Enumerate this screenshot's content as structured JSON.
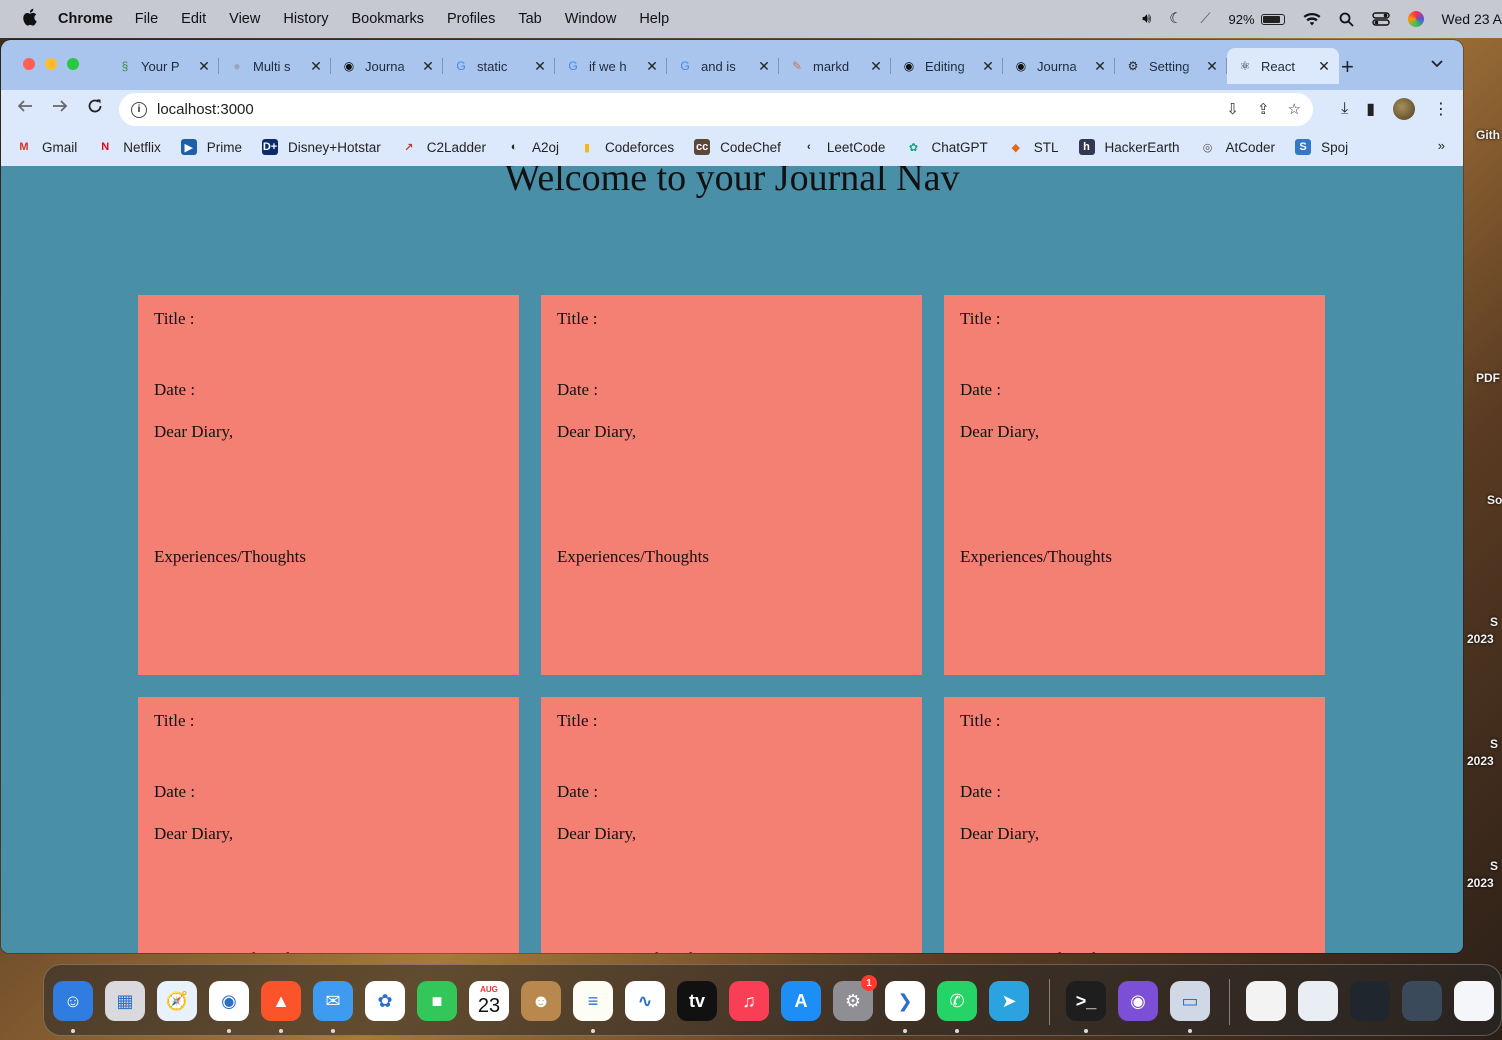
{
  "menubar": {
    "app_name": "Chrome",
    "items": [
      "File",
      "Edit",
      "View",
      "History",
      "Bookmarks",
      "Profiles",
      "Tab",
      "Window",
      "Help"
    ],
    "battery": "92%",
    "clock": "Wed 23 A"
  },
  "tabs": [
    {
      "label": "Your P",
      "icon": "tab-favicon",
      "color": "#3a8f3a",
      "glyph": "§"
    },
    {
      "label": "Multi s",
      "icon": "tab-favicon",
      "color": "#9aa6b8",
      "glyph": "●"
    },
    {
      "label": "Journa",
      "icon": "github-icon",
      "color": "#111111",
      "glyph": "◉"
    },
    {
      "label": "static",
      "icon": "google-icon",
      "color": "#4285f4",
      "glyph": "G"
    },
    {
      "label": "if we h",
      "icon": "google-icon",
      "color": "#4285f4",
      "glyph": "G"
    },
    {
      "label": "and is",
      "icon": "google-icon",
      "color": "#4285f4",
      "glyph": "G"
    },
    {
      "label": "markd",
      "icon": "tab-favicon",
      "color": "#c27a5a",
      "glyph": "✎"
    },
    {
      "label": "Editing",
      "icon": "github-icon",
      "color": "#111111",
      "glyph": "◉"
    },
    {
      "label": "Journa",
      "icon": "github-icon",
      "color": "#111111",
      "glyph": "◉"
    },
    {
      "label": "Setting",
      "icon": "gear-icon",
      "color": "#222222",
      "glyph": "⚙"
    },
    {
      "label": "React",
      "icon": "react-icon",
      "color": "#1b2a3a",
      "glyph": "⚛"
    }
  ],
  "address": {
    "url": "localhost:3000"
  },
  "bookmarks": [
    {
      "label": "Gmail",
      "glyph": "M",
      "color": "#d93025",
      "bg": "transparent"
    },
    {
      "label": "Netflix",
      "glyph": "N",
      "color": "#e50914",
      "bg": "transparent"
    },
    {
      "label": "Prime",
      "glyph": "▶",
      "color": "#ffffff",
      "bg": "#1f5fa8"
    },
    {
      "label": "Disney+Hotstar",
      "glyph": "D+",
      "color": "#ffffff",
      "bg": "#0b2b6b"
    },
    {
      "label": "C2Ladder",
      "glyph": "↗",
      "color": "#c0392b",
      "bg": "transparent"
    },
    {
      "label": "A2oj",
      "glyph": "◐",
      "color": "#222222",
      "bg": "transparent"
    },
    {
      "label": "Codeforces",
      "glyph": "▮",
      "color": "#f3b81a",
      "bg": "transparent"
    },
    {
      "label": "CodeChef",
      "glyph": "cc",
      "color": "#ffffff",
      "bg": "#5b4638"
    },
    {
      "label": "LeetCode",
      "glyph": "‹",
      "color": "#222222",
      "bg": "transparent"
    },
    {
      "label": "ChatGPT",
      "glyph": "✿",
      "color": "#10a37f",
      "bg": "transparent"
    },
    {
      "label": "STL",
      "glyph": "◆",
      "color": "#e06a1b",
      "bg": "transparent"
    },
    {
      "label": "HackerEarth",
      "glyph": "h",
      "color": "#ffffff",
      "bg": "#323754"
    },
    {
      "label": "AtCoder",
      "glyph": "◎",
      "color": "#555555",
      "bg": "transparent"
    },
    {
      "label": "Spoj",
      "glyph": "S",
      "color": "#ffffff",
      "bg": "#3178c6"
    }
  ],
  "page": {
    "heading": "Welcome to your Journal Nav",
    "cards": [
      {
        "title_label": "Title :",
        "date_label": "Date :",
        "greeting": "Dear Diary,",
        "body_label": "Experiences/Thoughts"
      },
      {
        "title_label": "Title :",
        "date_label": "Date :",
        "greeting": "Dear Diary,",
        "body_label": "Experiences/Thoughts"
      },
      {
        "title_label": "Title :",
        "date_label": "Date :",
        "greeting": "Dear Diary,",
        "body_label": "Experiences/Thoughts"
      },
      {
        "title_label": "Title :",
        "date_label": "Date :",
        "greeting": "Dear Diary,",
        "body_label": "Experiences/Thoughts"
      },
      {
        "title_label": "Title :",
        "date_label": "Date :",
        "greeting": "Dear Diary,",
        "body_label": "Experiences/Thoughts"
      },
      {
        "title_label": "Title :",
        "date_label": "Date :",
        "greeting": "Dear Diary,",
        "body_label": "Experiences/Thoughts"
      }
    ]
  },
  "desktop_labels": [
    "Gith",
    "PDF",
    "So",
    "S",
    "2023",
    "S",
    "2023",
    "S",
    "2023"
  ],
  "dock": {
    "calendar_month": "AUG",
    "calendar_day": "23",
    "settings_badge": "1",
    "apps": [
      {
        "name": "finder-icon",
        "bg": "#2f7de1",
        "glyph": "☺"
      },
      {
        "name": "launchpad-icon",
        "bg": "#d9d9de",
        "glyph": "▦"
      },
      {
        "name": "safari-icon",
        "bg": "#e8f2ff",
        "glyph": "🧭"
      },
      {
        "name": "chrome-icon",
        "bg": "#ffffff",
        "glyph": "◉"
      },
      {
        "name": "brave-icon",
        "bg": "#fb542b",
        "glyph": "▲"
      },
      {
        "name": "mail-icon",
        "bg": "#3e9bf0",
        "glyph": "✉"
      },
      {
        "name": "photos-icon",
        "bg": "#ffffff",
        "glyph": "✿"
      },
      {
        "name": "facetime-icon",
        "bg": "#33c759",
        "glyph": "■"
      },
      {
        "name": "calendar-icon",
        "bg": "#ffffff",
        "glyph": ""
      },
      {
        "name": "contacts-icon",
        "bg": "#b9884f",
        "glyph": "☻"
      },
      {
        "name": "notes-icon",
        "bg": "#fdfdf6",
        "glyph": "≡"
      },
      {
        "name": "freeform-icon",
        "bg": "#ffffff",
        "glyph": "∿"
      },
      {
        "name": "appletv-icon",
        "bg": "#111111",
        "glyph": "tv"
      },
      {
        "name": "music-icon",
        "bg": "#fa3e55",
        "glyph": "♫"
      },
      {
        "name": "appstore-icon",
        "bg": "#1d8ef5",
        "glyph": "A"
      },
      {
        "name": "system-settings-icon",
        "bg": "#8e8e93",
        "glyph": "⚙"
      },
      {
        "name": "vscode-icon",
        "bg": "#ffffff",
        "glyph": "❯"
      },
      {
        "name": "whatsapp-icon",
        "bg": "#25d366",
        "glyph": "✆"
      },
      {
        "name": "telegram-icon",
        "bg": "#2aa3e0",
        "glyph": "➤"
      },
      {
        "name": "terminal-icon",
        "bg": "#1e1e1e",
        "glyph": ">_"
      },
      {
        "name": "github-desktop-icon",
        "bg": "#7b4fd6",
        "glyph": "◉"
      },
      {
        "name": "preview-icon",
        "bg": "#cfd8e4",
        "glyph": "▭"
      },
      {
        "name": "recent-window-1-icon",
        "bg": "#f3f3f3",
        "glyph": ""
      },
      {
        "name": "recent-window-2-icon",
        "bg": "#e9eef5",
        "glyph": ""
      },
      {
        "name": "recent-window-3-icon",
        "bg": "#20262e",
        "glyph": ""
      },
      {
        "name": "recent-window-4-icon",
        "bg": "#3b4a5a",
        "glyph": ""
      },
      {
        "name": "recent-window-5-icon",
        "bg": "#f4f6f9",
        "glyph": ""
      }
    ]
  }
}
